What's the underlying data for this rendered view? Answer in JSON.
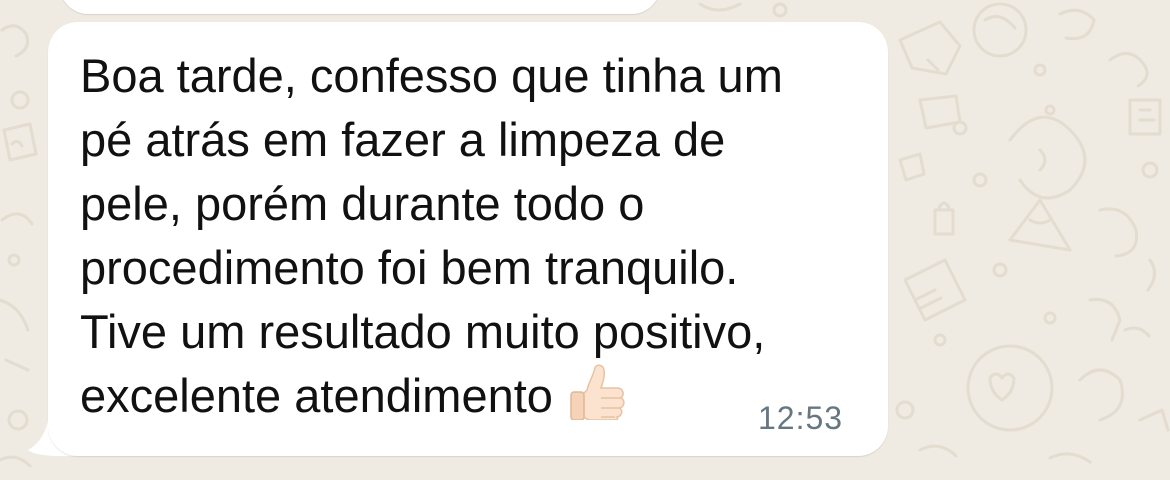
{
  "chat": {
    "background_color": "#efeae2",
    "bubble_color": "#ffffff",
    "message": {
      "lines": [
        "Boa tarde, confesso que tinha um",
        "pé atrás em fazer a limpeza de",
        "pele, porém durante todo o",
        "procedimento foi bem tranquilo.",
        "Tive um resultado muito positivo,",
        "excelente atendimento"
      ],
      "emoji": "thumbs-up-icon",
      "timestamp": "12:53"
    }
  }
}
